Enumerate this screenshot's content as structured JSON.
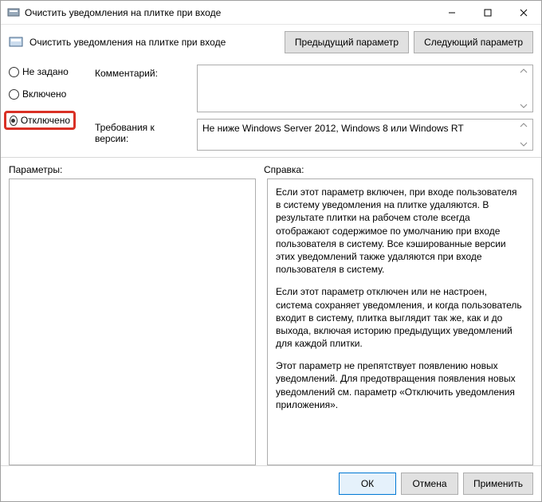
{
  "window": {
    "title": "Очистить уведомления на плитке при входе"
  },
  "header": {
    "subtitle": "Очистить уведомления на плитке при входе",
    "prev": "Предыдущий параметр",
    "next": "Следующий параметр"
  },
  "radios": {
    "not_configured": "Не задано",
    "enabled": "Включено",
    "disabled": "Отключено"
  },
  "fields": {
    "comment_label": "Комментарий:",
    "comment_value": "",
    "requirements_label": "Требования к версии:",
    "requirements_value": "Не ниже Windows Server 2012, Windows 8 или Windows RT"
  },
  "sections": {
    "options_label": "Параметры:",
    "help_label": "Справка:"
  },
  "help": {
    "p1": "Если этот параметр включен, при входе пользователя в систему уведомления на плитке удаляются. В результате плитки на рабочем столе всегда отображают содержимое по умолчанию при входе пользователя в систему. Все кэшированные версии этих уведомлений также удаляются при входе пользователя в систему.",
    "p2": "Если этот параметр отключен или не настроен, система сохраняет уведомления, и когда пользователь входит в систему, плитка выглядит так же, как и до выхода, включая историю предыдущих уведомлений для каждой плитки.",
    "p3": "Этот параметр не препятствует появлению новых уведомлений. Для предотвращения появления новых уведомлений см. параметр «Отключить уведомления приложения»."
  },
  "footer": {
    "ok": "ОК",
    "cancel": "Отмена",
    "apply": "Применить"
  }
}
